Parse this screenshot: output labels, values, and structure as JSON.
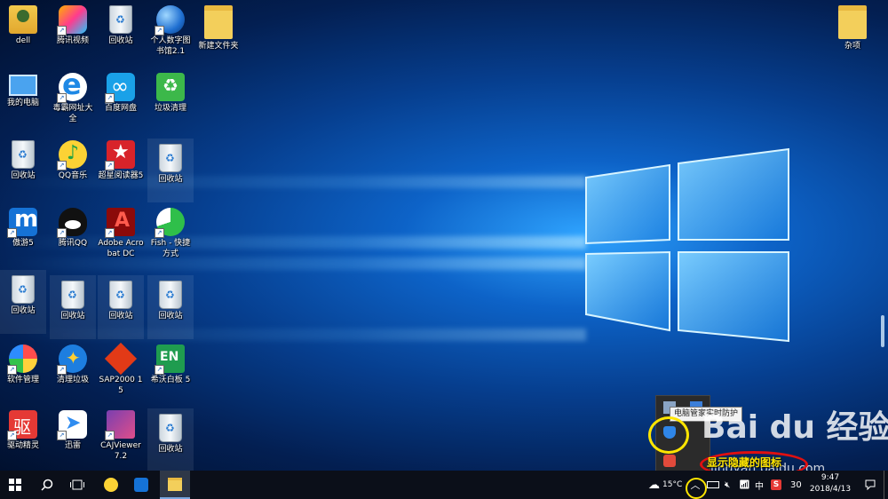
{
  "desktop": {
    "icons": [
      {
        "label": "dell",
        "glyph": "user-folder-icon"
      },
      {
        "label": "腾讯视频",
        "glyph": "tencent-video-icon"
      },
      {
        "label": "回收站",
        "glyph": "recycle-bin-icon"
      },
      {
        "label": "个人数字图书馆2.1",
        "glyph": "digital-library-icon"
      },
      {
        "label": "新建文件夹",
        "glyph": "folder-icon"
      },
      {
        "label": "我的电脑",
        "glyph": "computer-icon"
      },
      {
        "label": "毒霸网址大全",
        "glyph": "ie-browser-icon"
      },
      {
        "label": "百度网盘",
        "glyph": "baidu-netdisk-icon"
      },
      {
        "label": "垃圾清理",
        "glyph": "junk-clean-icon"
      },
      {
        "label": "回收站",
        "glyph": "recycle-bin-icon"
      },
      {
        "label": "QQ音乐",
        "glyph": "qq-music-icon"
      },
      {
        "label": "超星阅读器5",
        "glyph": "superstar-reader-icon"
      },
      {
        "label": "回收站",
        "glyph": "recycle-bin-icon"
      },
      {
        "label": "傲游5",
        "glyph": "maxthon-icon"
      },
      {
        "label": "腾讯QQ",
        "glyph": "qq-penguin-icon"
      },
      {
        "label": "Adobe Acrobat DC",
        "glyph": "acrobat-icon"
      },
      {
        "label": "Fish - 快捷方式",
        "glyph": "fish-icon"
      },
      {
        "label": "回收站",
        "glyph": "recycle-bin-icon"
      },
      {
        "label": "回收站",
        "glyph": "recycle-bin-icon"
      },
      {
        "label": "回收站",
        "glyph": "recycle-bin-icon"
      },
      {
        "label": "回收站",
        "glyph": "recycle-bin-icon"
      },
      {
        "label": "软件管理",
        "glyph": "software-manager-icon"
      },
      {
        "label": "清理垃圾",
        "glyph": "broom-clean-icon"
      },
      {
        "label": "SAP2000 15",
        "glyph": "sap2000-icon"
      },
      {
        "label": "希沃白板 5",
        "glyph": "seewo-board-icon"
      },
      {
        "label": "驱动精灵",
        "glyph": "driver-genius-icon"
      },
      {
        "label": "迅雷",
        "glyph": "xunlei-icon"
      },
      {
        "label": "CAJViewer 7.2",
        "glyph": "cajviewer-icon"
      },
      {
        "label": "回收站",
        "glyph": "recycle-bin-icon"
      },
      {
        "label": "杂项",
        "glyph": "folder-icon"
      }
    ]
  },
  "tray_popup": {
    "tooltip": "电脑管家实时防护"
  },
  "annotation": {
    "text": "显示隐藏的图标"
  },
  "watermark": {
    "brand": "Bai du 经验",
    "url": "jingyan.baidu.com"
  },
  "taskbar": {
    "weather_temp": "15°C",
    "ime_label": "中",
    "sogou_label": "S",
    "badge_number": "30",
    "time": "9:47",
    "date": "2018/4/13"
  },
  "colors": {
    "annotation_yellow": "#ffe500",
    "annotation_red": "#e01010",
    "taskbar_bg": "#0b0f19"
  }
}
